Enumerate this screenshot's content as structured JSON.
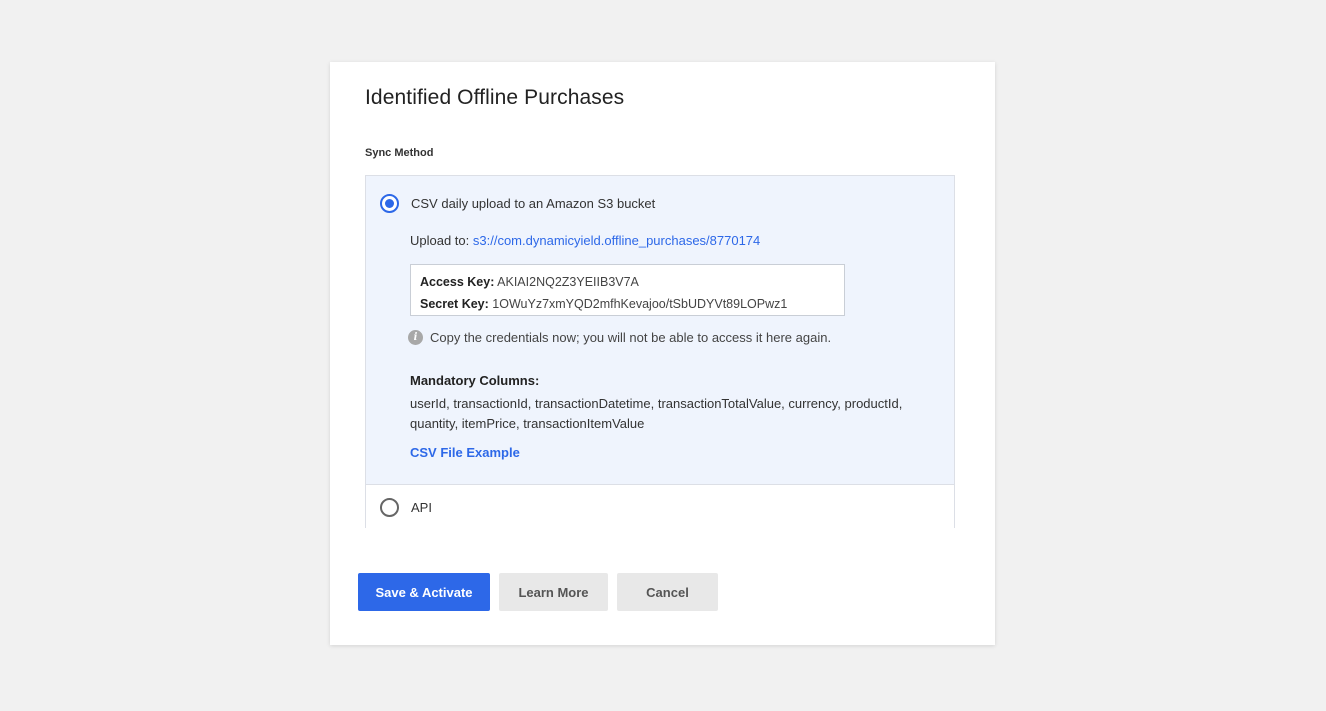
{
  "modal": {
    "title": "Identified Offline Purchases",
    "section_label": "Sync Method"
  },
  "options": {
    "csv": {
      "label": "CSV daily upload to an Amazon S3 bucket",
      "selected": true,
      "upload_prefix": "Upload to:",
      "upload_url": "s3://com.dynamicyield.offline_purchases/8770174",
      "access_key_label": "Access Key:",
      "access_key_value": "AKIAI2NQ2Z3YEIIB3V7A",
      "secret_key_label": "Secret Key:",
      "secret_key_value": "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",
      "info_icon": "i",
      "info_text": "Copy the credentials now; you will not be able to access it here again.",
      "mandatory_title": "Mandatory Columns:",
      "mandatory_columns": "userId, transactionId, transactionDatetime, transactionTotalValue, currency, productId, quantity, itemPrice, transactionItemValue",
      "example_link": "CSV File Example"
    },
    "api": {
      "label": "API",
      "selected": false
    }
  },
  "buttons": {
    "save": "Save & Activate",
    "learn": "Learn More",
    "cancel": "Cancel"
  },
  "colors": {
    "accent": "#2d68e8",
    "selected_bg": "#eff4fd",
    "page_bg": "#f1f1f1"
  }
}
